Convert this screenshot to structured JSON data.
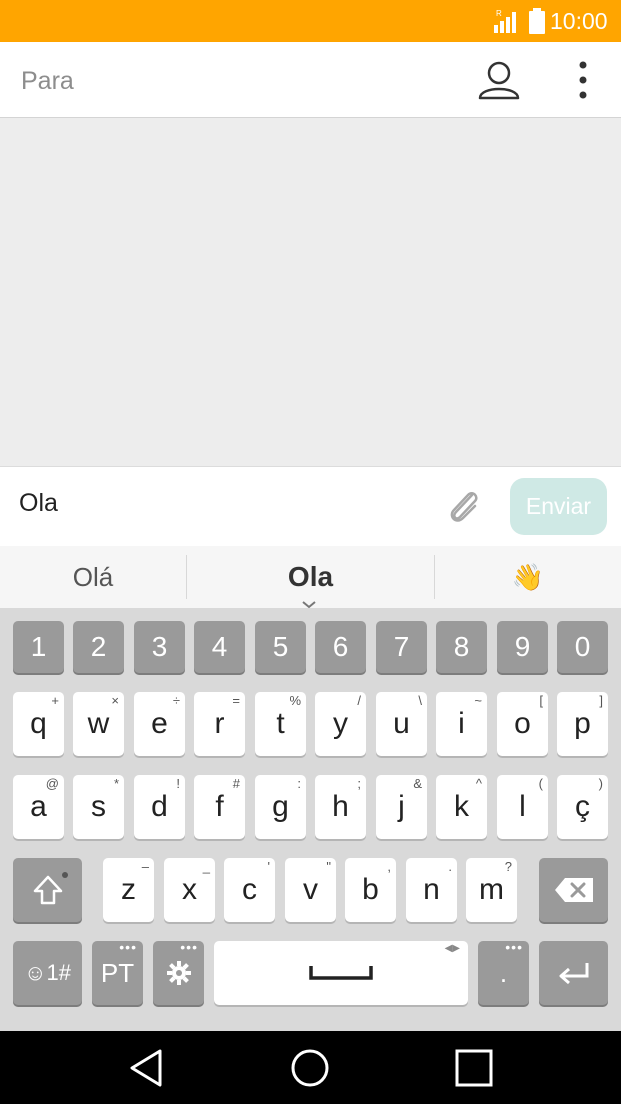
{
  "status_bar": {
    "time": "10:00",
    "network_indicator": "R",
    "icons": [
      "signal-icon",
      "battery-icon"
    ],
    "color": "#FFA500"
  },
  "header": {
    "to_placeholder": "Para",
    "icons": [
      "contact-icon",
      "overflow-menu-icon"
    ]
  },
  "compose": {
    "message": "Ola",
    "send_label": "Enviar",
    "icons": [
      "paperclip-icon"
    ]
  },
  "suggestions": [
    {
      "text": "Olá"
    },
    {
      "text": "Ola"
    },
    {
      "text": "👋"
    }
  ],
  "keyboard": {
    "numbers": [
      "1",
      "2",
      "3",
      "4",
      "5",
      "6",
      "7",
      "8",
      "9",
      "0"
    ],
    "row1": [
      {
        "key": "q",
        "sub": "+"
      },
      {
        "key": "w",
        "sub": "×"
      },
      {
        "key": "e",
        "sub": "÷"
      },
      {
        "key": "r",
        "sub": "="
      },
      {
        "key": "t",
        "sub": "%"
      },
      {
        "key": "y",
        "sub": "/"
      },
      {
        "key": "u",
        "sub": "\\"
      },
      {
        "key": "i",
        "sub": "~"
      },
      {
        "key": "o",
        "sub": "["
      },
      {
        "key": "p",
        "sub": "]"
      }
    ],
    "row2": [
      {
        "key": "a",
        "sub": "@"
      },
      {
        "key": "s",
        "sub": "*"
      },
      {
        "key": "d",
        "sub": "!"
      },
      {
        "key": "f",
        "sub": "#"
      },
      {
        "key": "g",
        "sub": ":"
      },
      {
        "key": "h",
        "sub": ";"
      },
      {
        "key": "j",
        "sub": "&"
      },
      {
        "key": "k",
        "sub": "^"
      },
      {
        "key": "l",
        "sub": "("
      },
      {
        "key": "ç",
        "sub": ")"
      }
    ],
    "row3": [
      {
        "key": "z",
        "sub": "–"
      },
      {
        "key": "x",
        "sub": "_"
      },
      {
        "key": "c",
        "sub": "'"
      },
      {
        "key": "v",
        "sub": "\""
      },
      {
        "key": "b",
        "sub": ","
      },
      {
        "key": "n",
        "sub": "."
      },
      {
        "key": "m",
        "sub": "?"
      }
    ],
    "symbols_label": "☺1#",
    "language_label": "PT",
    "period_label": "."
  },
  "accent_color": "#CFE9E5"
}
